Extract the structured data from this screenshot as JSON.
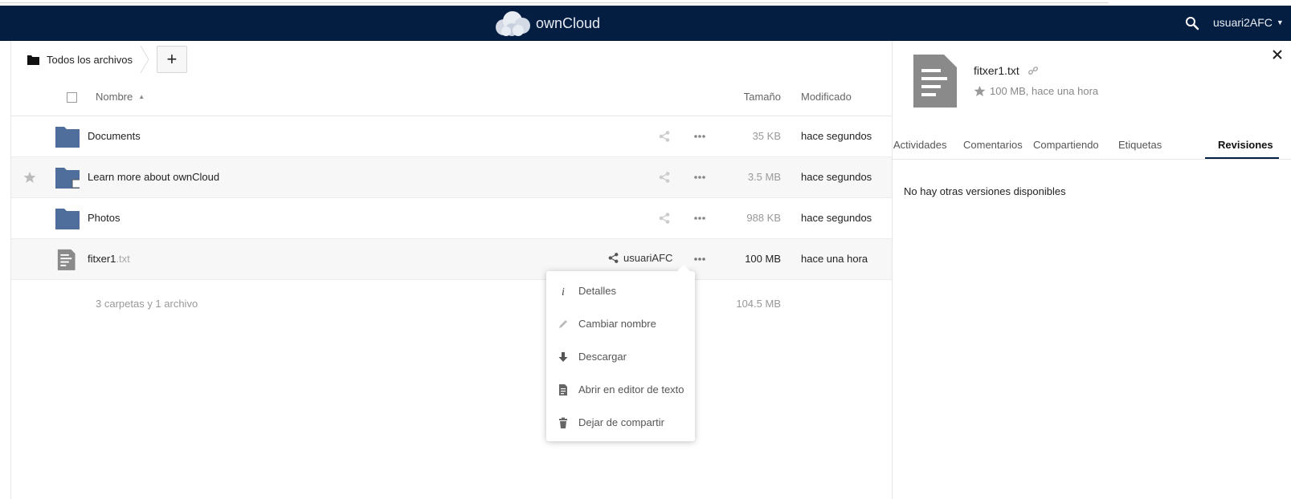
{
  "header": {
    "app_name": "ownCloud",
    "user_label": "usuari2AFC",
    "colors": {
      "bg": "#041e42",
      "text": "#e8ecf3"
    }
  },
  "breadcrumb": {
    "home_label": "Todos los archivos",
    "new_button_label": "+"
  },
  "table": {
    "col_name": "Nombre",
    "col_size": "Tamaño",
    "col_modified": "Modificado",
    "rows": [
      {
        "name": "Documents",
        "ext": "",
        "size": "35 KB",
        "modified": "hace segundos",
        "type": "folder"
      },
      {
        "name": "Learn more about ownCloud",
        "ext": "",
        "size": "3.5 MB",
        "modified": "hace segundos",
        "type": "folder-shared"
      },
      {
        "name": "Photos",
        "ext": "",
        "size": "988 KB",
        "modified": "hace segundos",
        "type": "folder"
      },
      {
        "name": "fitxer1",
        "ext": ".txt",
        "size": "100 MB",
        "modified": "hace una hora",
        "type": "text-file",
        "shared_with": "usuariAFC"
      }
    ],
    "summary_count": "3 carpetas y 1 archivo",
    "summary_size": "104.5 MB"
  },
  "dropdown": {
    "items": [
      {
        "label": "Detalles",
        "icon": "info-icon"
      },
      {
        "label": "Cambiar nombre",
        "icon": "pencil-icon"
      },
      {
        "label": "Descargar",
        "icon": "download-icon"
      },
      {
        "label": "Abrir en editor de texto",
        "icon": "document-icon"
      },
      {
        "label": "Dejar de compartir",
        "icon": "trash-icon"
      }
    ]
  },
  "sidebar": {
    "file_name": "fitxer1.txt",
    "meta": "100 MB, hace una hora",
    "tabs": [
      "Actividades",
      "Comentarios",
      "Compartiendo",
      "Etiquetas",
      "Revisiones"
    ],
    "active_tab": "Revisiones",
    "content": "No hay otras versiones disponibles"
  }
}
